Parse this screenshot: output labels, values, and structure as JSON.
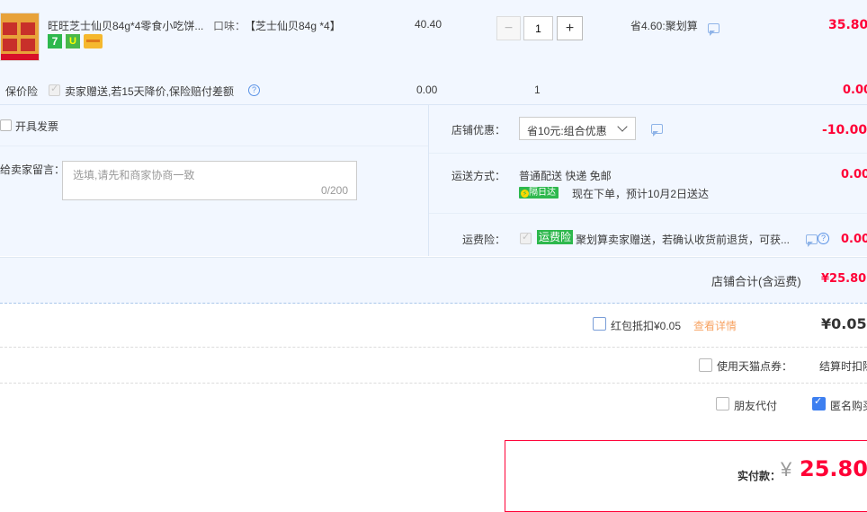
{
  "item": {
    "title": "旺旺芝士仙贝84g*4零食小吃饼...",
    "flavor_label": "口味：",
    "flavor_value": "【芝士仙贝84g *4】",
    "unit_price": "40.40",
    "quantity": "1",
    "minus": "−",
    "plus": "+",
    "discount": "省4.60:聚划算",
    "subtotal": "35.80",
    "badge_7": "7",
    "badge_u": "U"
  },
  "insurance": {
    "label": "保价险",
    "desc": "卖家赠送,若15天降价,保险赔付差额",
    "price": "0.00",
    "qty": "1",
    "total": "0.00"
  },
  "invoice": {
    "label": "开具发票"
  },
  "message": {
    "label": "给卖家留言：",
    "placeholder": "选填,请先和商家协商一致",
    "counter": "0/200"
  },
  "shop_discount": {
    "label": "店铺优惠：",
    "selected": "省10元:组合优惠",
    "amount": "-10.00"
  },
  "shipping": {
    "label": "运送方式：",
    "method": "普通配送 快递 免邮",
    "badge": "隔日达",
    "eta": "现在下单，预计10月2日送达",
    "amount": "0.00"
  },
  "freight_ins": {
    "label": "运费险：",
    "tag": "运费险",
    "desc": "聚划算卖家赠送，若确认收货前退货，可获...",
    "amount": "0.00"
  },
  "shop_total": {
    "label": "店铺合计(含运费)",
    "amount": "¥25.80"
  },
  "redpacket": {
    "label": "红包抵扣¥0.05",
    "link": "查看详情",
    "amount": "¥0.05"
  },
  "tmall_points": {
    "label": "使用天猫点券：",
    "note": "结算时扣除"
  },
  "friend_pay": {
    "label": "朋友代付"
  },
  "anonymous": {
    "label": "匿名购买"
  },
  "pay": {
    "label": "实付款：",
    "currency": "¥",
    "amount": "25.80"
  },
  "colors": {
    "accent": "#ff0036",
    "link": "#3d7ff0",
    "panel": "#f2f7ff",
    "border": "#b8d0f0"
  }
}
